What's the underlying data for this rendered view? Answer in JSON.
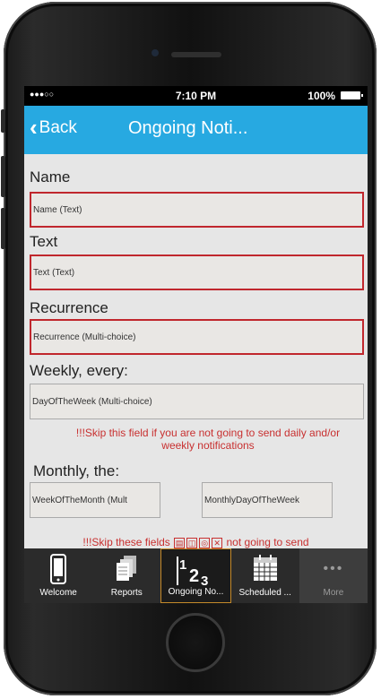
{
  "status_bar": {
    "signal": "●●●○○",
    "time": "7:10 PM",
    "battery": "100%"
  },
  "nav": {
    "back_label": "Back",
    "title": "Ongoing Noti..."
  },
  "form": {
    "name_label": "Name",
    "name_placeholder": "Name (Text)",
    "text_label": "Text",
    "text_placeholder": "Text (Text)",
    "recurrence_label": "Recurrence",
    "recurrence_placeholder": "Recurrence (Multi-choice)",
    "weekly_label": "Weekly, every:",
    "weekly_placeholder": "DayOfTheWeek (Multi-choice)",
    "weekly_warning": "!!!Skip this field if you are not going to send daily and/or weekly notifications",
    "monthly_label": "Monthly, the:",
    "monthly_week_placeholder": "WeekOfTheMonth (Mult",
    "monthly_day_placeholder": "MonthlyDayOfTheWeek",
    "monthly_warning_start": "!!!Skip these fields",
    "monthly_warning_end": "not going to send"
  },
  "tabs": [
    {
      "label": "Welcome",
      "icon": "phone-icon"
    },
    {
      "label": "Reports",
      "icon": "documents-icon"
    },
    {
      "label": "Ongoing No...",
      "icon": "numbers-icon",
      "active": true
    },
    {
      "label": "Scheduled ...",
      "icon": "calendar-icon"
    },
    {
      "label": "More",
      "icon": "more-dots-icon"
    }
  ],
  "colors": {
    "nav_bar": "#27a9e1",
    "required_border": "#c0272d",
    "warning_text": "#c83030",
    "tab_bar": "#2b2b2b",
    "active_tab_border": "#c58a2a"
  }
}
